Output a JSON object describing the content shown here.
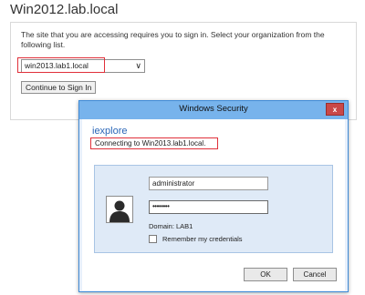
{
  "page": {
    "title": "Win2012.lab.local"
  },
  "signin": {
    "message": "The site that you are accessing requires you to sign in. Select your organization from the following list.",
    "org_select_value": "win2013.lab1.local",
    "continue_label": "Continue to Sign In"
  },
  "dialog": {
    "title": "Windows Security",
    "close_label": "x",
    "app_name": "iexplore",
    "connecting_text": "Connecting to Win2013.lab1.local.",
    "username_value": "administrator",
    "password_value": "••••••••",
    "domain_text": "Domain: LAB1",
    "remember_label": "Remember my credentials",
    "ok_label": "OK",
    "cancel_label": "Cancel"
  },
  "colors": {
    "highlight": "#e0303a",
    "titlebar": "#77b3ec",
    "panel": "#dfeaf7",
    "app_name": "#2a66b8"
  }
}
